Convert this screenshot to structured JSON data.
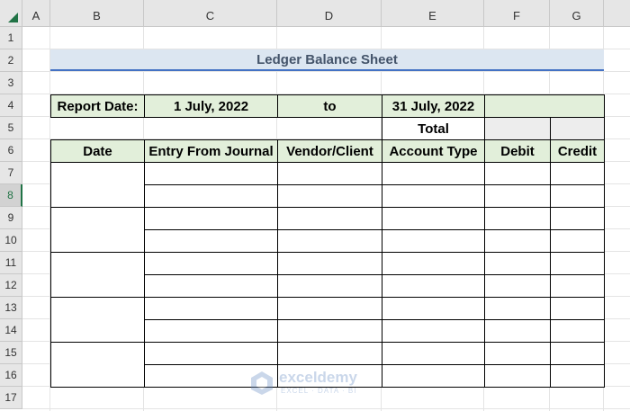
{
  "columns": [
    "A",
    "B",
    "C",
    "D",
    "E",
    "F",
    "G"
  ],
  "rows": [
    "1",
    "2",
    "3",
    "4",
    "5",
    "6",
    "7",
    "8",
    "9",
    "10",
    "11",
    "12",
    "13",
    "14",
    "15",
    "16",
    "17"
  ],
  "selected_row": "8",
  "title": "Ledger Balance Sheet",
  "report": {
    "label": "Report Date:",
    "from_date": "1 July, 2022",
    "to_label": "to",
    "to_date": "31 July, 2022"
  },
  "total_label": "Total",
  "headers": {
    "date": "Date",
    "entry": "Entry From Journal",
    "vendor": "Vendor/Client",
    "account": "Account Type",
    "debit": "Debit",
    "credit": "Credit"
  },
  "watermark": {
    "name": "exceldemy",
    "tagline": "EXCEL · DATA · BI"
  },
  "colors": {
    "title_fill": "#dce6f1",
    "title_border": "#4472c4",
    "header_fill": "#e2efda",
    "total_fill": "#ededed",
    "excel_green": "#217346"
  }
}
